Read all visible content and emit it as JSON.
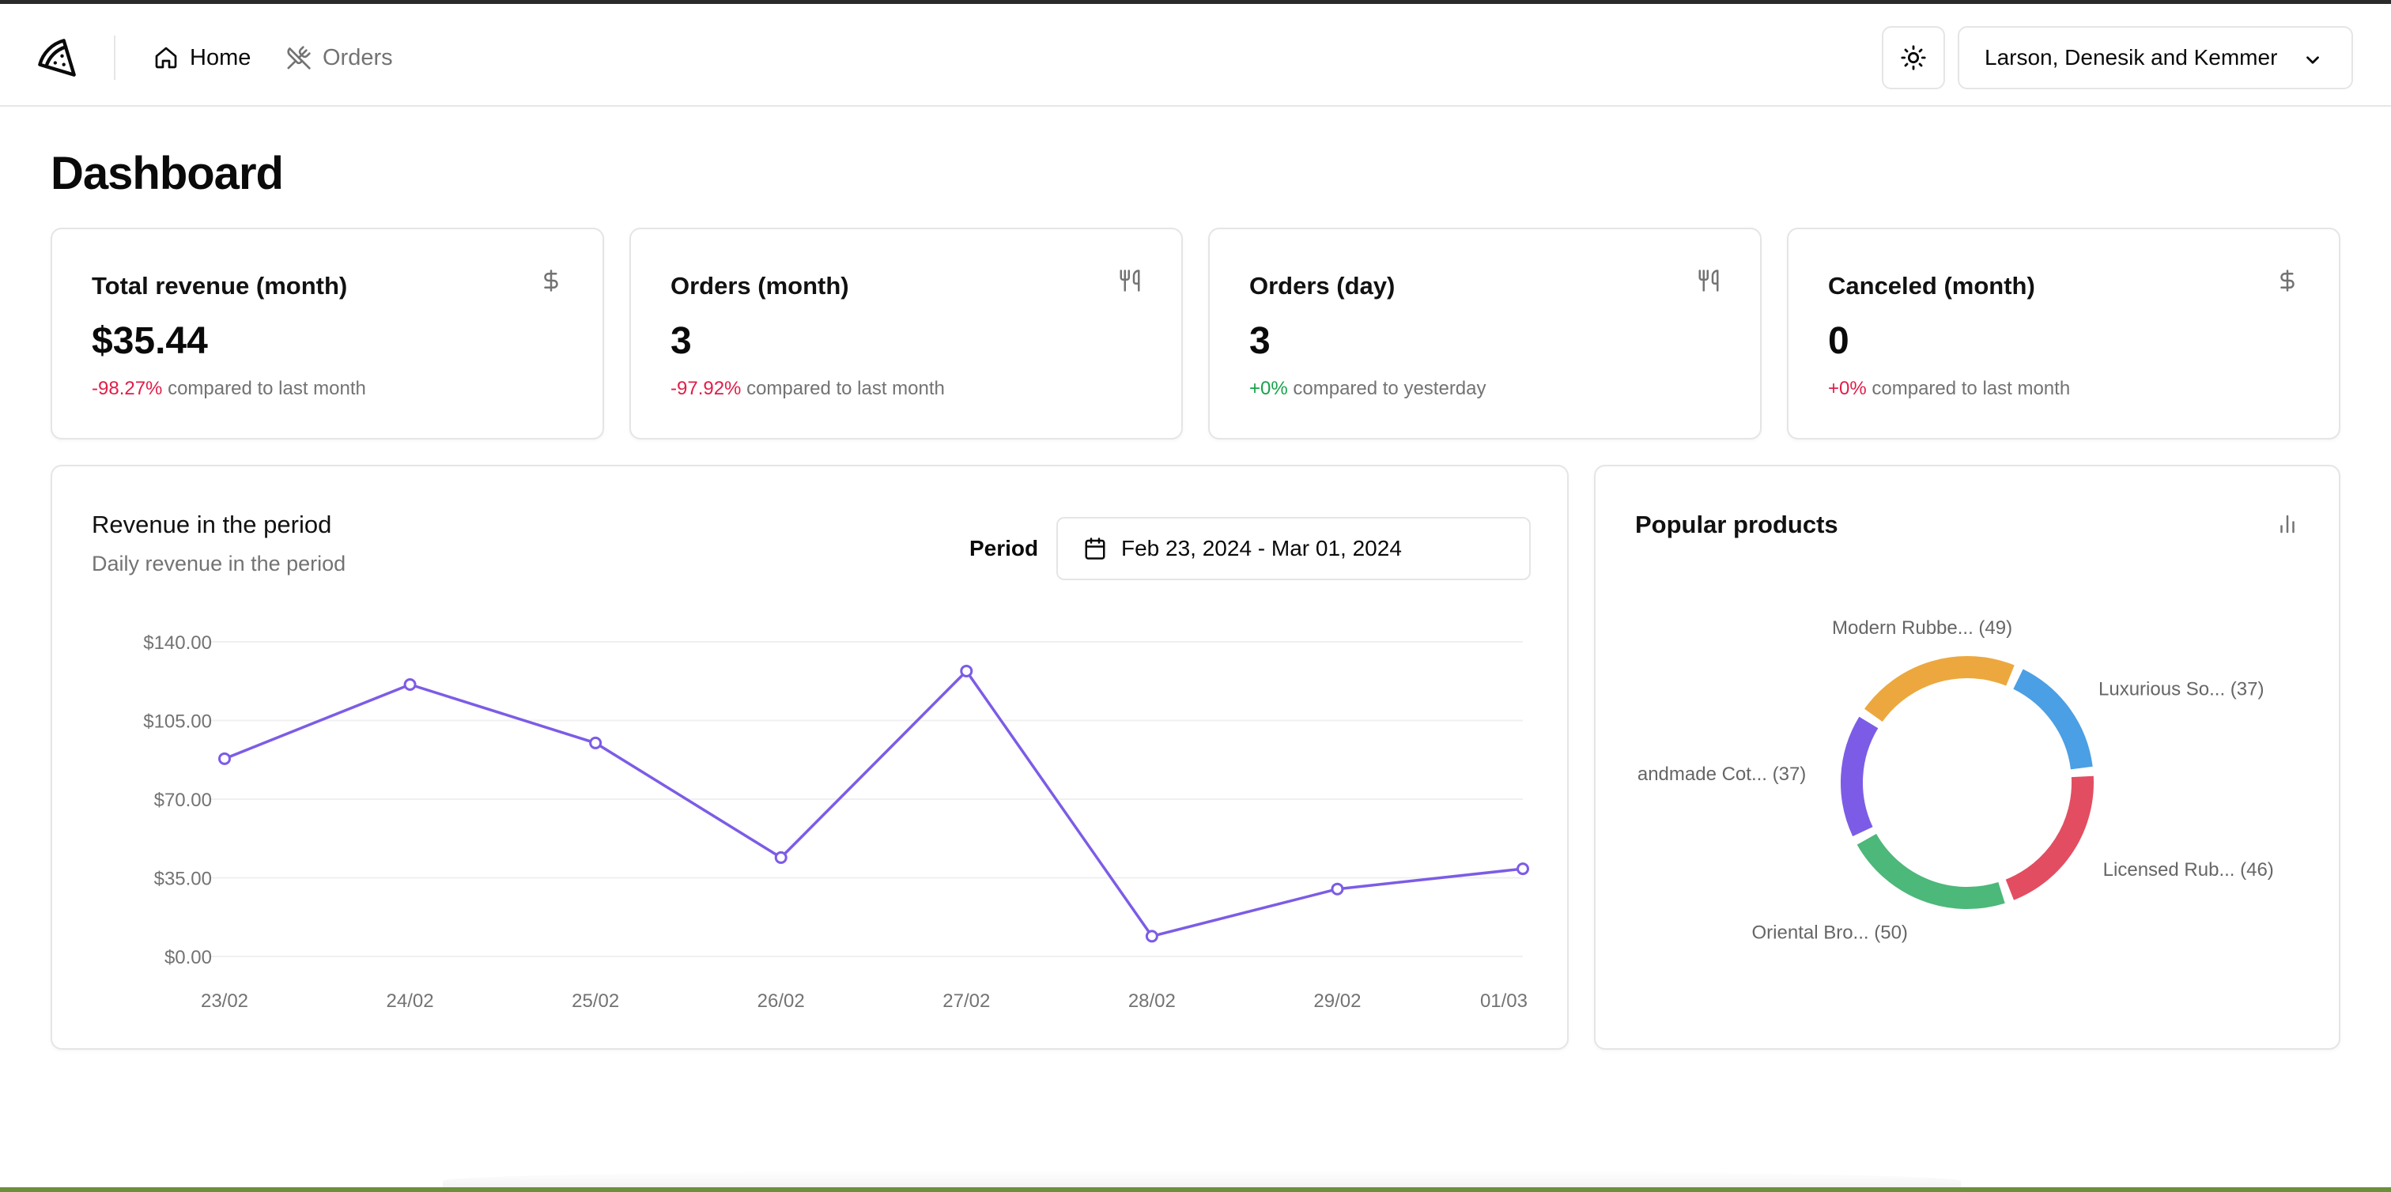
{
  "header": {
    "nav": [
      {
        "label": "Home",
        "icon": "home-icon",
        "active": true
      },
      {
        "label": "Orders",
        "icon": "utensils-crossed-icon",
        "active": false
      }
    ],
    "theme_icon": "sun-icon",
    "store": {
      "name": "Larson, Denesik and Kemmer",
      "icon": "chevron-down-icon"
    }
  },
  "page": {
    "title": "Dashboard"
  },
  "stats": [
    {
      "label": "Total revenue (month)",
      "icon": "dollar-icon",
      "value": "$35.44",
      "diff": "-98.27%",
      "diff_trend": "negative",
      "compare": "compared to last month"
    },
    {
      "label": "Orders (month)",
      "icon": "utensils-icon",
      "value": "3",
      "diff": "-97.92%",
      "diff_trend": "negative",
      "compare": "compared to last month"
    },
    {
      "label": "Orders (day)",
      "icon": "utensils-icon",
      "value": "3",
      "diff": "+0%",
      "diff_trend": "positive",
      "compare": "compared to yesterday"
    },
    {
      "label": "Canceled (month)",
      "icon": "dollar-icon",
      "value": "0",
      "diff": "+0%",
      "diff_trend": "negative",
      "compare": "compared to last month"
    }
  ],
  "revenue": {
    "title": "Revenue in the period",
    "subtitle": "Daily revenue in the period",
    "period_label": "Period",
    "period_value": "Feb 23, 2024 - Mar 01, 2024",
    "calendar_icon": "calendar-icon"
  },
  "popular": {
    "title": "Popular products",
    "icon": "bar-chart-icon"
  },
  "chart_data": [
    {
      "type": "line",
      "title": "Revenue in the period",
      "subtitle": "Daily revenue in the period",
      "x": [
        "23/02",
        "24/02",
        "25/02",
        "26/02",
        "27/02",
        "28/02",
        "29/02",
        "01/03"
      ],
      "series": [
        {
          "values": [
            88,
            121,
            95,
            44,
            127,
            9,
            30,
            39
          ],
          "color": "#7c5ce6"
        }
      ],
      "y_ticks": [
        "$0.00",
        "$35.00",
        "$70.00",
        "$105.00",
        "$140.00"
      ],
      "ylim": [
        0,
        140
      ],
      "grid": true
    },
    {
      "type": "pie",
      "title": "Popular products",
      "slices": [
        {
          "label": "Luxurious So... (37)",
          "value": 37,
          "color": "#4b9fe4"
        },
        {
          "label": "Licensed Rub... (46)",
          "value": 46,
          "color": "#e34d61"
        },
        {
          "label": "Oriental Bro... (50)",
          "value": 50,
          "color": "#4cb87a"
        },
        {
          "label": "andmade Cot... (37)",
          "value": 37,
          "color": "#7c5ce6"
        },
        {
          "label": "Modern Rubbe... (49)",
          "value": 49,
          "color": "#eca83f"
        }
      ]
    }
  ]
}
